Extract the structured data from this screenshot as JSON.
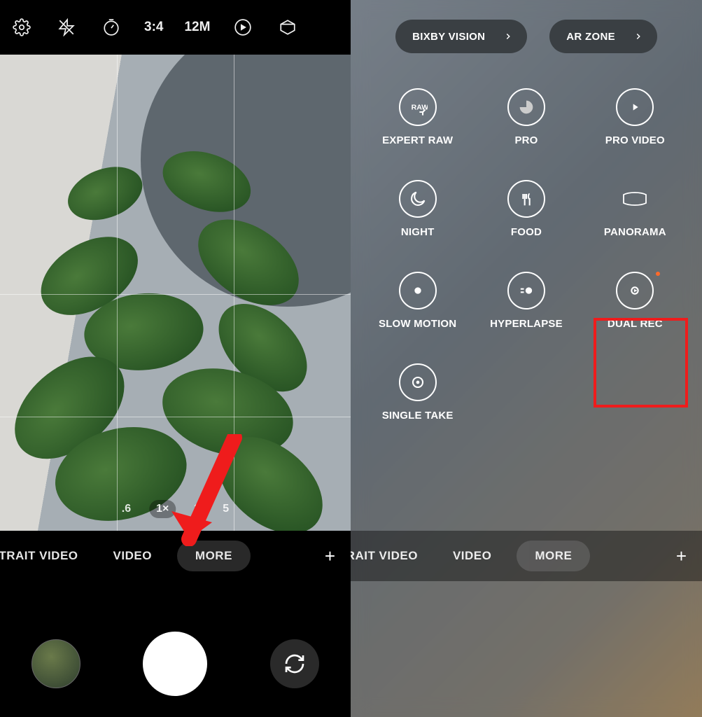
{
  "topbar": {
    "aspect_ratio": "3:4",
    "resolution": "12M"
  },
  "zoom": {
    "levels": [
      ".6",
      "1×",
      "3",
      "5"
    ],
    "selected_index": 1
  },
  "left": {
    "modes": {
      "portrait_video": "PORTRAIT VIDEO",
      "video": "VIDEO",
      "more": "MORE"
    }
  },
  "right": {
    "pills": {
      "bixby_vision": "BIXBY VISION",
      "ar_zone": "AR ZONE"
    },
    "grid": {
      "expert_raw": "EXPERT RAW",
      "pro": "PRO",
      "pro_video": "PRO VIDEO",
      "night": "NIGHT",
      "food": "FOOD",
      "panorama": "PANORAMA",
      "slow_motion": "SLOW MOTION",
      "hyperlapse": "HYPERLAPSE",
      "dual_rec": "DUAL REC",
      "single_take": "SINGLE TAKE"
    },
    "modes": {
      "portrait_video": "RTRAIT VIDEO",
      "video": "VIDEO",
      "more": "MORE"
    }
  }
}
